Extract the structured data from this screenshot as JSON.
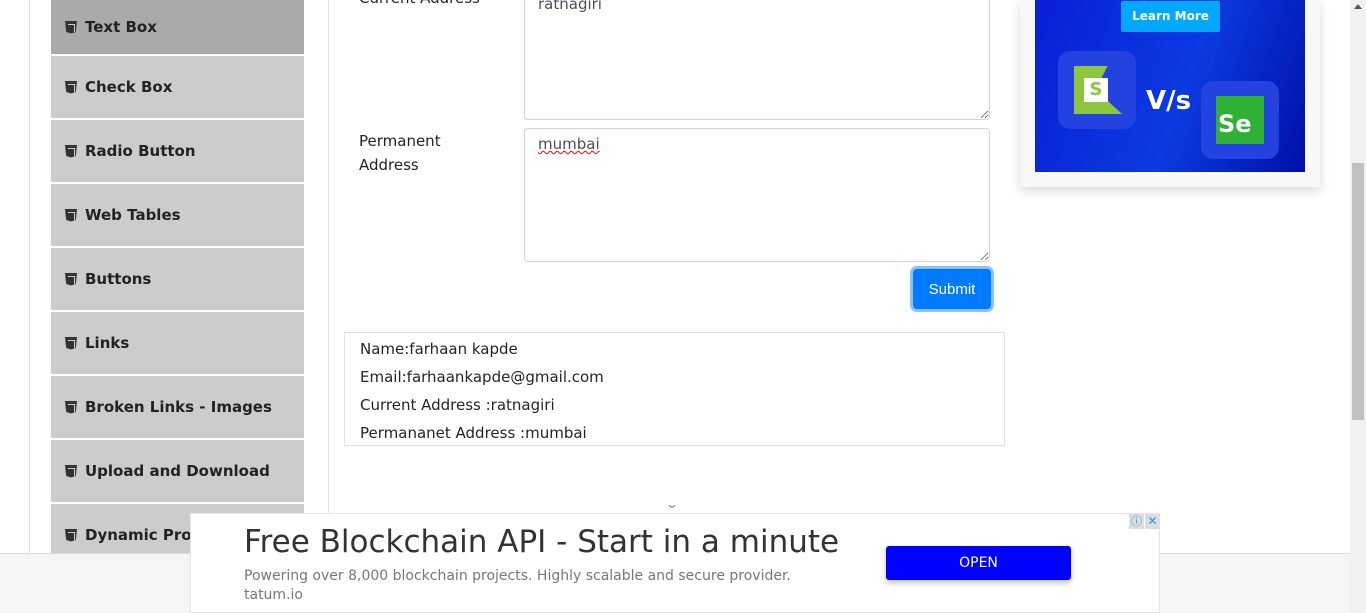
{
  "sidebar": {
    "items": [
      {
        "label": "Text Box",
        "active": true
      },
      {
        "label": "Check Box"
      },
      {
        "label": "Radio Button"
      },
      {
        "label": "Web Tables"
      },
      {
        "label": "Buttons"
      },
      {
        "label": "Links"
      },
      {
        "label": "Broken Links - Images"
      },
      {
        "label": "Upload and Download"
      },
      {
        "label": "Dynamic Properties"
      }
    ]
  },
  "form": {
    "current_address_label": "Current Address",
    "current_address_value": "ratnagiri",
    "permanent_address_label_1": "Permanent",
    "permanent_address_label_2": "Address",
    "permanent_address_value": "mumbai",
    "submit_label": "Submit"
  },
  "output": {
    "name": "Name:farhaan kapde",
    "email": "Email:farhaankapde@gmail.com",
    "current": "Current Address :ratnagiri",
    "permanent": "Permananet Address :mumbai"
  },
  "side_ad": {
    "button": "Learn More",
    "vs": "V/s",
    "left_logo": "S",
    "right_logo": "Se"
  },
  "bottom_ad": {
    "title": "Free Blockchain API - Start in a minute",
    "description": "Powering over 8,000 blockchain projects. Highly scalable and secure provider.",
    "domain": "tatum.io",
    "cta": "OPEN",
    "cta_color": "#0000ff"
  },
  "colors": {
    "primary": "#007bff",
    "sidebar": "#cccccc",
    "sidebar_active": "#aaaaaa"
  }
}
